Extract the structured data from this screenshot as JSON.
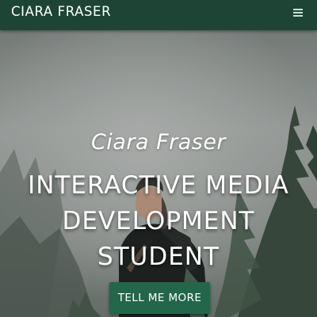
{
  "header": {
    "brand": "CIARA FRASER",
    "menu_icon": "hamburger-menu-icon"
  },
  "hero": {
    "name": "Ciara Fraser",
    "title": "INTERACTIVE MEDIA DEVELOPMENT STUDENT",
    "cta_label": "TELL ME MORE",
    "background": "foggy-forest-portrait-photo"
  },
  "colors": {
    "navbar": "#1d4434",
    "cta": "#23664a",
    "text": "#ffffff",
    "menu_icon": "#cfe1d7"
  }
}
